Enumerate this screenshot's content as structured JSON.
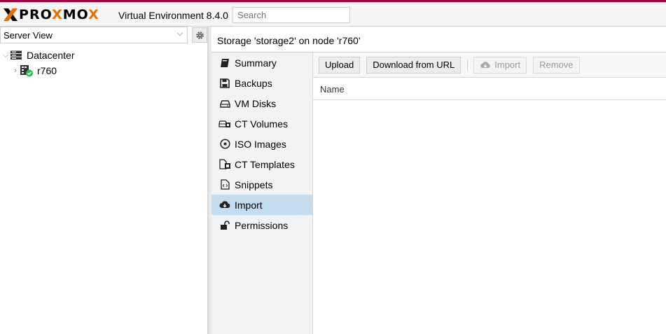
{
  "header": {
    "logo_text": "PROXMOX",
    "version_label": "Virtual Environment 8.4.0",
    "search_placeholder": "Search",
    "accent_color": "#a40040",
    "brand_orange": "#e57000"
  },
  "left": {
    "view_selector": "Server View",
    "tree": [
      {
        "label": "Datacenter",
        "icon": "datacenter-icon",
        "expanded": true
      },
      {
        "label": "r760",
        "icon": "node-online-icon",
        "expanded": false
      }
    ]
  },
  "content": {
    "title": "Storage 'storage2' on node 'r760'",
    "nav": [
      {
        "label": "Summary",
        "icon": "book-icon"
      },
      {
        "label": "Backups",
        "icon": "floppy-icon"
      },
      {
        "label": "VM Disks",
        "icon": "hdd-icon"
      },
      {
        "label": "CT Volumes",
        "icon": "ct-volume-icon"
      },
      {
        "label": "ISO Images",
        "icon": "disc-icon"
      },
      {
        "label": "CT Templates",
        "icon": "ct-template-icon"
      },
      {
        "label": "Snippets",
        "icon": "code-file-icon"
      },
      {
        "label": "Import",
        "icon": "cloud-download-icon",
        "active": true
      },
      {
        "label": "Permissions",
        "icon": "unlock-icon"
      }
    ],
    "toolbar": {
      "upload": "Upload",
      "download_url": "Download from URL",
      "import": "Import",
      "remove": "Remove"
    },
    "grid": {
      "columns": [
        "Name"
      ]
    }
  }
}
